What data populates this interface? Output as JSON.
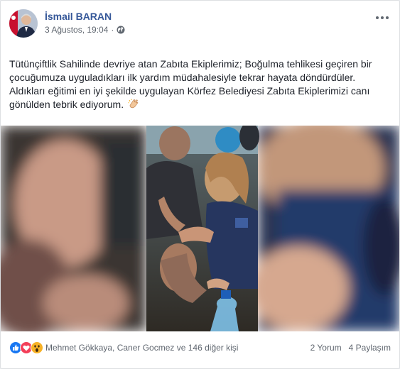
{
  "post": {
    "author": "İsmail BARAN",
    "date": "3 Ağustos, 19:04",
    "separator": "·",
    "privacy_icon": "globe-icon",
    "menu_icon": "more-options-icon",
    "text": "Tütünçiftlik Sahilinde devriye atan Zabıta Ekiplerimiz; Boğulma tehlikesi geçiren bir çocuğumuza uyguladıkları ilk yardım müdahalesiyle tekrar hayata döndürdüler. Aldıkları eğitimi en iyi şekilde uygulayan Körfez Belediyesi Zabıta Ekiplerimizi canı gönülden tebrik ediyorum.",
    "text_emoji": "👏"
  },
  "reactions": {
    "icons": [
      "like-reaction-icon",
      "love-reaction-icon",
      "wow-reaction-icon"
    ],
    "names": "Mehmet Gökkaya, Caner Gocmez ve 146 diğer kişi",
    "comments": "2 Yorum",
    "shares": "4 Paylaşım"
  },
  "colors": {
    "author_link": "#365899",
    "like": "#1877f2",
    "love": "#f33e58",
    "wow": "#f7b125"
  }
}
